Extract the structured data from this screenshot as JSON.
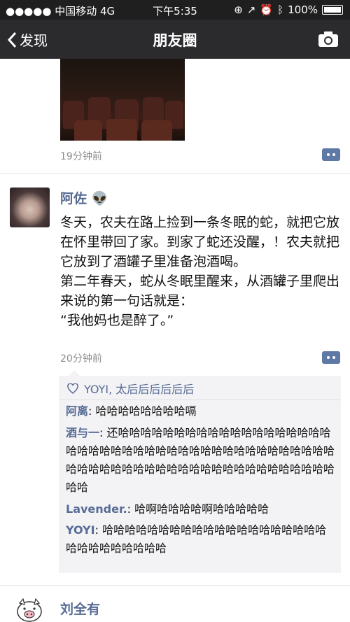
{
  "status": {
    "carrier": "●●●●● 中国移动 4G",
    "time": "下午5:35",
    "battery": "100%"
  },
  "nav": {
    "back_label": "发现",
    "title": "朋友圈"
  },
  "post1": {
    "time": "19分钟前"
  },
  "post2": {
    "name": "阿佐 👽",
    "text": "冬天，农夫在路上捡到一条冬眠的蛇，就把它放在怀里带回了家。到家了蛇还没醒，！农夫就把它放到了酒罐子里准备泡酒喝。\n第二年春天，蛇从冬眠里醒来，从酒罐子里爬出来说的第一句话就是：\n“我他妈也是醉了。”",
    "time": "20分钟前",
    "likes": "YOYI, 太后后后后后后",
    "comments": [
      {
        "name": "阿离",
        "text": ": 哈哈哈哈哈哈哈哈嗝"
      },
      {
        "name": "酒与一",
        "text": ": 还哈哈哈哈哈哈哈哈哈哈哈哈哈哈哈哈哈哈哈哈哈哈哈哈哈哈哈哈哈哈哈哈哈哈哈哈哈哈哈哈哈哈哈哈哈哈哈哈哈哈哈哈哈哈哈哈哈哈哈哈哈哈哈哈哈哈哈哈哈"
      },
      {
        "name": "Lavender.",
        "text": ": 哈啊哈哈哈哈啊哈哈哈哈哈"
      },
      {
        "name": "YOYI",
        "text": ": 哈哈哈哈哈哈哈哈哈哈哈哈哈哈哈哈哈哈哈哈哈哈哈哈哈哈哈哈哈"
      }
    ]
  },
  "post3": {
    "name": "刘全有"
  }
}
